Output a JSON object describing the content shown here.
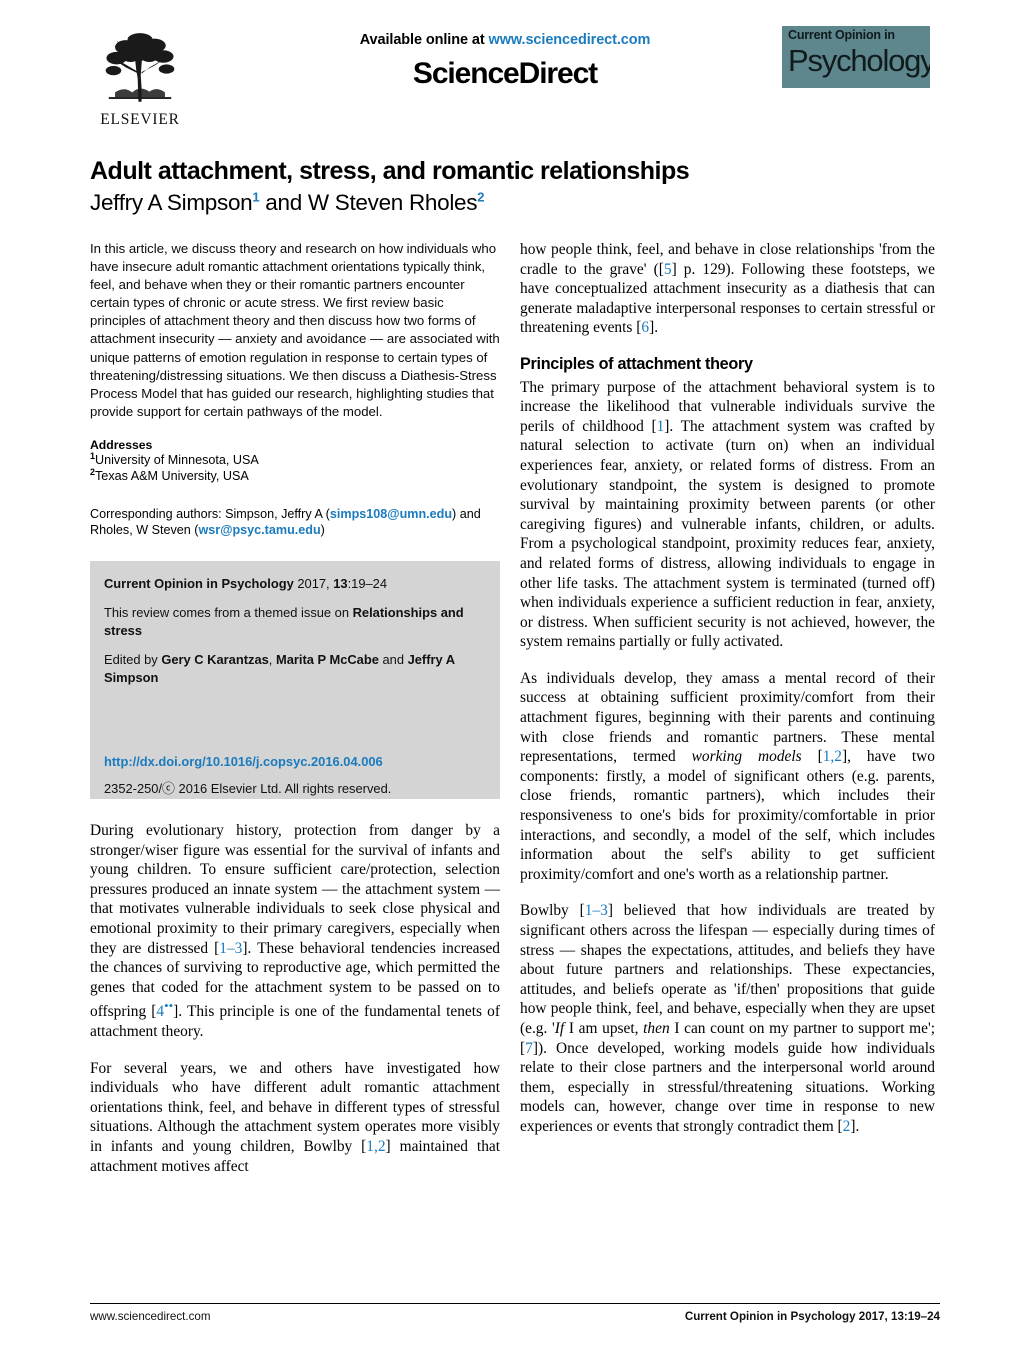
{
  "header": {
    "available_online": "Available online at",
    "sciencedirect_url": "www.sciencedirect.com",
    "sciencedirect_wordmark": "ScienceDirect",
    "elsevier_wordmark": "ELSEVIER",
    "journal_logo_line1": "Current Opinion in",
    "journal_logo_line2": "Psychology",
    "logo_color": "#5d868d",
    "link_color": "#1a7bbf"
  },
  "article": {
    "title": "Adult attachment, stress, and romantic relationships",
    "authors_part1": "Jeffry A Simpson",
    "authors_sup1": "1",
    "authors_conj": " and ",
    "authors_part2": "W Steven Rholes",
    "authors_sup2": "2"
  },
  "abstract": {
    "text": "In this article, we discuss theory and research on how individuals who have insecure adult romantic attachment orientations typically think, feel, and behave when they or their romantic partners encounter certain types of chronic or acute stress. We first review basic principles of attachment theory and then discuss how two forms of attachment insecurity — anxiety and avoidance — are associated with unique patterns of emotion regulation in response to certain types of threatening/distressing situations. We then discuss a Diathesis-Stress Process Model that has guided our research, highlighting studies that provide support for certain pathways of the model."
  },
  "addresses": {
    "heading": "Addresses",
    "items": [
      {
        "sup": "1",
        "text": "University of Minnesota, USA"
      },
      {
        "sup": "2",
        "text": "Texas A&M University, USA"
      }
    ]
  },
  "correspondence": {
    "prefix": "Corresponding authors: Simpson, Jeffry A (",
    "email1": "simps108@umn.edu",
    "middle": ") and Rholes, W Steven (",
    "email2": "wsr@psyc.tamu.edu",
    "suffix": ")"
  },
  "citation_box": {
    "journal_bold": "Current Opinion in Psychology",
    "journal_rest": " 2017, ",
    "volume": "13",
    "pages": ":19–24",
    "themed_prefix": "This review comes from a themed issue on ",
    "themed_bold": "Relationships and stress",
    "edited_prefix": "Edited by ",
    "editor1": "Gery C Karantzas",
    "editor_sep1": ", ",
    "editor2": "Marita P McCabe",
    "editor_sep2": " and ",
    "editor3": "Jeffry A Simpson",
    "doi": "http://dx.doi.org/10.1016/j.copsyc.2016.04.006",
    "copyright": "2352-250/ⓒ 2016 Elsevier Ltd. All rights reserved."
  },
  "left_body": {
    "p1_a": "During evolutionary history, protection from danger by a stronger/wiser figure was essential for the survival of infants and young children. To ensure sufficient care/protection, selection pressures produced an innate system — the attachment system — that motivates vulnerable individuals to seek close physical and emotional proximity to their primary caregivers, especially when they are distressed [",
    "p1_ref1": "1–3",
    "p1_b": "]. These behavioral tendencies increased the chances of surviving to reproductive age, which permitted the genes that coded for the attachment system to be passed on to offspring [",
    "p1_ref2": "4",
    "p1_ref2_sup": "••",
    "p1_c": "]. This principle is one of the fundamental tenets of attachment theory.",
    "p2_a": "For several years, we and others have investigated how individuals who have different adult romantic attachment orientations think, feel, and behave in different types of stressful situations. Although the attachment system operates more visibly in infants and young children, Bowlby [",
    "p2_ref1": "1,2",
    "p2_b": "] maintained that attachment motives affect"
  },
  "right_body": {
    "p0_a": "how people think, feel, and behave in close relationships 'from the cradle to the grave' ([",
    "p0_ref1": "5",
    "p0_b": "] p. 129). Following these footsteps, we have conceptualized attachment insecurity as a diathesis that can generate maladaptive interpersonal responses to certain stressful or threatening events [",
    "p0_ref2": "6",
    "p0_c": "].",
    "section_heading": "Principles of attachment theory",
    "p1_a": "The primary purpose of the attachment behavioral system is to increase the likelihood that vulnerable individuals survive the perils of childhood [",
    "p1_ref1": "1",
    "p1_b": "]. The attachment system was crafted by natural selection to activate (turn on) when an individual experiences fear, anxiety, or related forms of distress. From an evolutionary standpoint, the system is designed to promote survival by maintaining proximity between parents (or other caregiving figures) and vulnerable infants, children, or adults. From a psychological standpoint, proximity reduces fear, anxiety, and related forms of distress, allowing individuals to engage in other life tasks. The attachment system is terminated (turned off) when individuals experience a sufficient reduction in fear, anxiety, or distress. When sufficient security is not achieved, however, the system remains partially or fully activated.",
    "p2_a": "As individuals develop, they amass a mental record of their success at obtaining sufficient proximity/comfort from their attachment figures, beginning with their parents and continuing with close friends and romantic partners. These mental representations, termed ",
    "p2_italic1": "working models",
    "p2_b": " [",
    "p2_ref1": "1,2",
    "p2_c": "], have two components: firstly, a model of significant others (e.g. parents, close friends, romantic partners), which includes their responsiveness to one's bids for proximity/comfortable in prior interactions, and secondly, a model of the self, which includes information about the self's ability to get sufficient proximity/comfort and one's worth as a relationship partner.",
    "p3_a": "Bowlby [",
    "p3_ref1": "1–3",
    "p3_b": "] believed that how individuals are treated by significant others across the lifespan — especially during times of stress — shapes the expectations, attitudes, and beliefs they have about future partners and relationships. These expectancies, attitudes, and beliefs operate as 'if/then' propositions that guide how people think, feel, and behave, especially when they are upset (e.g. '",
    "p3_italic1": "If",
    "p3_c": " I am upset, ",
    "p3_italic2": "then",
    "p3_d": " I can count on my partner to support me'; [",
    "p3_ref2": "7",
    "p3_e": "]). Once developed, working models guide how individuals relate to their close partners and the interpersonal world around them, especially in stressful/threatening situations. Working models can, however, change over time in response to new experiences or events that strongly contradict them [",
    "p3_ref3": "2",
    "p3_f": "]."
  },
  "footer": {
    "left": "www.sciencedirect.com",
    "right": "Current Opinion in Psychology 2017, 13:19–24"
  }
}
